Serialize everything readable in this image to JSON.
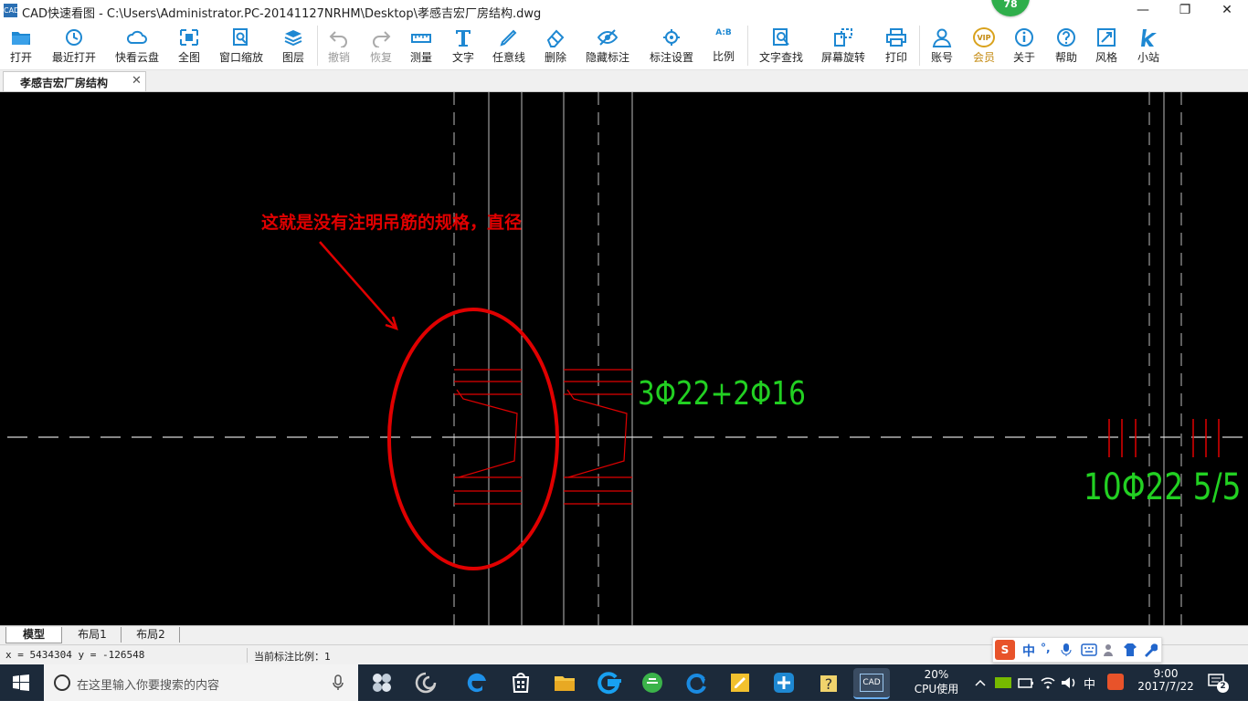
{
  "window": {
    "title": "CAD快速看图 - C:\\Users\\Administrator.PC-20141127NRHM\\Desktop\\孝感吉宏厂房结构.dwg",
    "app_icon_text": "CAD",
    "badge": "78",
    "minimize": "—",
    "restore": "❐",
    "close": "✕"
  },
  "toolbar": {
    "open": "打开",
    "recent": "最近打开",
    "cloud": "快看云盘",
    "full": "全图",
    "window_zoom": "窗口缩放",
    "layer": "图层",
    "undo": "撤销",
    "redo": "恢复",
    "measure": "测量",
    "text": "文字",
    "freeline": "任意线",
    "delete": "删除",
    "hide_annot": "隐藏标注",
    "annot_settings": "标注设置",
    "ratio": "比例",
    "text_search": "文字查找",
    "rotate": "屏幕旋转",
    "print": "打印",
    "account": "账号",
    "vip": "会员",
    "about": "关于",
    "help": "帮助",
    "style": "风格",
    "site": "小站",
    "ratio_icon_text": "A:B",
    "vip_icon_text": "VIP"
  },
  "document_tab": {
    "title": "孝感吉宏厂房结构",
    "close": "✕"
  },
  "drawing": {
    "annotation": "这就是没有注明吊筋的规格，直径",
    "rebar_label_1": "3Φ22+2Φ16",
    "rebar_label_2": "10Φ22 5/5"
  },
  "layout_tabs": [
    "模型",
    "布局1",
    "布局2"
  ],
  "status": {
    "coords": "x = 5434304  y = -126548",
    "scale": "当前标注比例：1"
  },
  "ime": {
    "logo": "S",
    "lang": "中",
    "punct": "°,"
  },
  "taskbar": {
    "search_placeholder": "在这里输入你要搜索的内容",
    "active_app": "CAD",
    "cpu_value": "20%",
    "cpu_label": "CPU使用",
    "ime_lang": "中",
    "time": "9:00",
    "date": "2017/7/22",
    "notifications": "2"
  },
  "colors": {
    "canvas": "#000000",
    "annotation": "#e00000",
    "rebar_text": "#22d022",
    "accent": "#1e88d2"
  }
}
